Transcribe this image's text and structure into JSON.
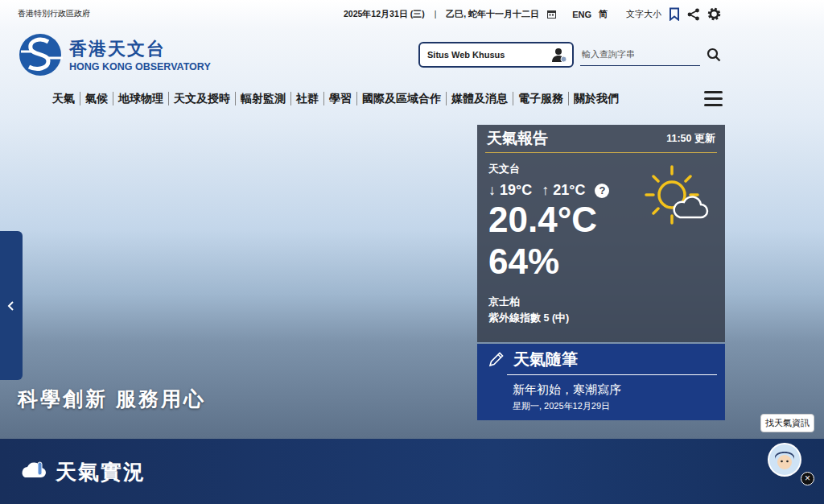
{
  "topbar": {
    "gov": "香港特別行政區政府",
    "date": "2025年12月31日 (三)",
    "separator": "|",
    "lunar": "乙巳, 蛇年十一月十二日",
    "languages": [
      "ENG",
      "简"
    ],
    "font_size": "文字大小"
  },
  "logo": {
    "zh": "香港天文台",
    "en": "HONG KONG OBSERVATORY"
  },
  "special_site": "Situs Web Khusus",
  "search": {
    "placeholder": "輸入查詢字串"
  },
  "nav": [
    "天氣",
    "氣候",
    "地球物理",
    "天文及授時",
    "輻射監測",
    "社群",
    "學習",
    "國際及區域合作",
    "媒體及消息",
    "電子服務",
    "關於我們"
  ],
  "hero": {
    "slogan": "科學創新 服務用心"
  },
  "weather": {
    "title": "天氣報告",
    "updated": "11:50 更新",
    "station": "天文台",
    "min_arrow": "↓",
    "min": "19°C",
    "max_arrow": "↑",
    "max": "21°C",
    "help": "?",
    "temperature": "20.4°C",
    "humidity": "64%",
    "uv_station": "京士柏",
    "uv": "紫外線指數 5 (中)"
  },
  "blog": {
    "title": "天氣隨筆",
    "headline": "新年初始，寒潮寫序",
    "date": "星期一, 2025年12月29日"
  },
  "section": {
    "title": "天氣實況"
  },
  "chatbot": {
    "label": "找天氣資訊",
    "close": "×"
  }
}
